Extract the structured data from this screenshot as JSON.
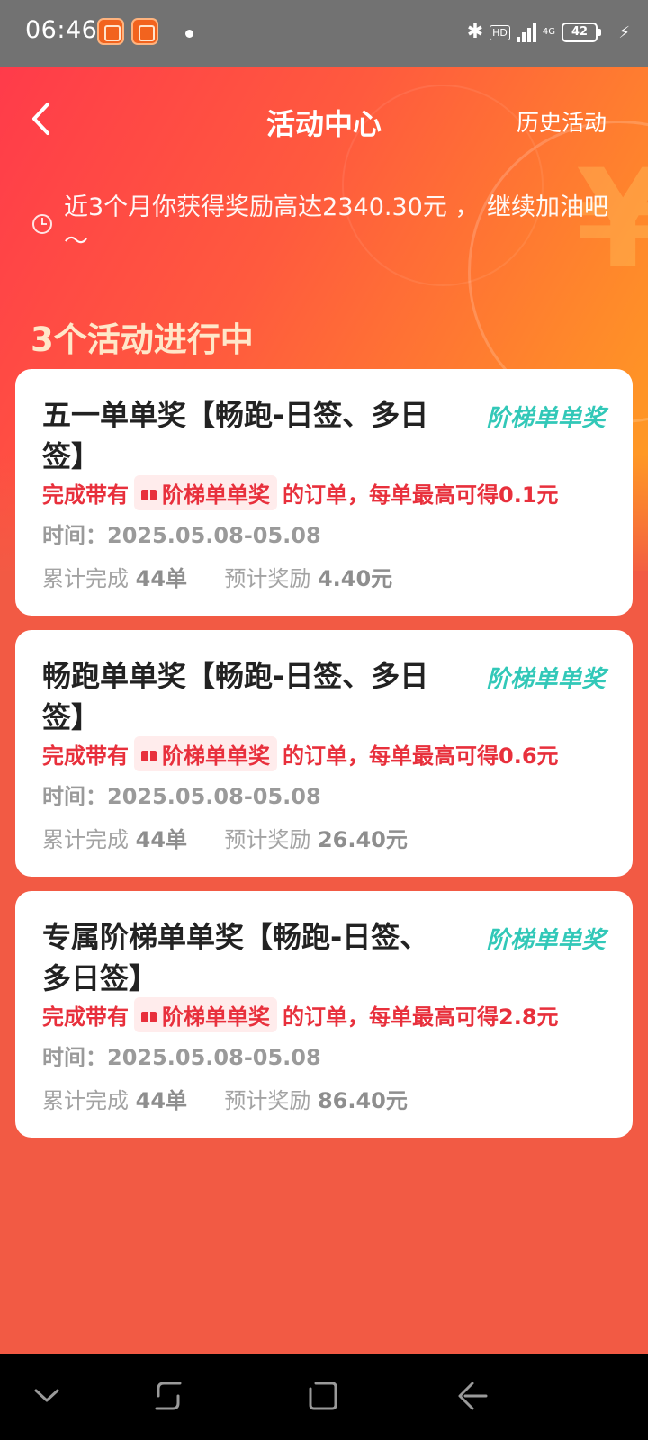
{
  "status_bar": {
    "time": "06:46",
    "hd": "HD",
    "network": "4G",
    "battery": "42"
  },
  "header": {
    "title": "活动中心",
    "history_label": "历史活动"
  },
  "reward_summary": "近3个月你获得奖励高达2340.30元 ， 继续加油吧～",
  "section_title": "3个活动进行中",
  "activities": [
    {
      "title": "五一单单奖【畅跑-日签、多日签】",
      "tag": "阶梯单单奖",
      "desc_prefix": "完成带有",
      "chip_label": "阶梯单单奖",
      "desc_suffix": "的订单，每单最高可得0.1元",
      "time": "时间：2025.05.08-05.08",
      "completed_label": "累计完成",
      "completed_value": "44单",
      "reward_label": "预计奖励",
      "reward_value": "4.40元"
    },
    {
      "title": "畅跑单单奖【畅跑-日签、多日签】",
      "tag": "阶梯单单奖",
      "desc_prefix": "完成带有",
      "chip_label": "阶梯单单奖",
      "desc_suffix": "的订单，每单最高可得0.6元",
      "time": "时间：2025.05.08-05.08",
      "completed_label": "累计完成",
      "completed_value": "44单",
      "reward_label": "预计奖励",
      "reward_value": "26.40元"
    },
    {
      "title": "专属阶梯单单奖【畅跑-日签、多日签】",
      "tag": "阶梯单单奖",
      "desc_prefix": "完成带有",
      "chip_label": "阶梯单单奖",
      "desc_suffix": "的订单，每单最高可得2.8元",
      "time": "时间：2025.05.08-05.08",
      "completed_label": "累计完成",
      "completed_value": "44单",
      "reward_label": "预计奖励",
      "reward_value": "86.40元"
    }
  ],
  "colors": {
    "accent_red": "#e8303c",
    "tag_teal": "#32c8b8",
    "section_title": "#ffe7c9"
  }
}
